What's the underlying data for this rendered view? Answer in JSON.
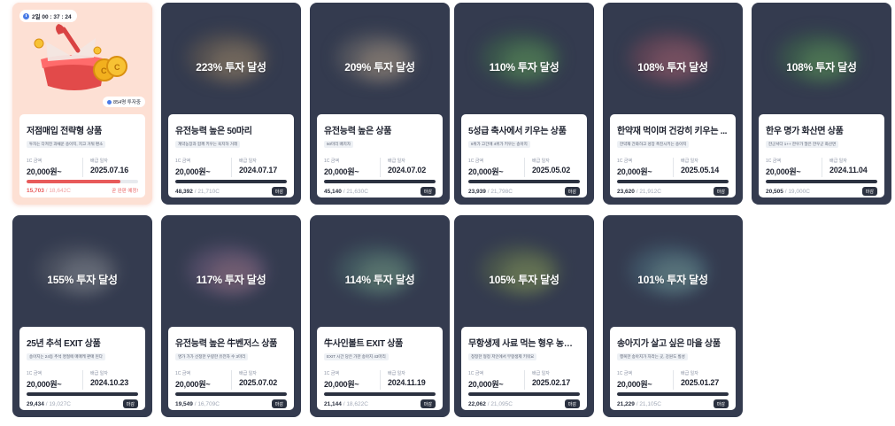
{
  "featured": {
    "timer": "2일 00 : 37 : 24",
    "investors": "854명 투자중",
    "title": "저점매입 전략형 상품",
    "tag": "투자는 다져진 과채운 송아지, 지고 거둬 편소",
    "amount_label": "1C 금액",
    "amount": "20,000원~",
    "date_label": "배급 일자",
    "date": "2025.07.16",
    "sold": "15,703",
    "total": "18,642C",
    "progress": 0.84,
    "status": "곧 완판 예정!"
  },
  "cards": [
    {
      "overlay": "223% 투자 달성",
      "title": "유전능력 높은 50마리",
      "tag": "계약농장과 함께 키우는 육지하 거래",
      "amount_label": "1C 금액",
      "amount": "20,000원~",
      "date_label": "배급 일자",
      "date": "2024.07.17",
      "sold": "48,392",
      "total": "21,710C",
      "progress": 1.0,
      "badge": "마감"
    },
    {
      "overlay": "209% 투자 달성",
      "title": "유전능력 높은 상품",
      "tag": "50마리 배치자",
      "amount_label": "1C 금액",
      "amount": "20,000원~",
      "date_label": "배급 일자",
      "date": "2024.07.02",
      "sold": "45,140",
      "total": "21,630C",
      "progress": 1.0,
      "badge": "마감"
    },
    {
      "overlay": "110% 투자 달성",
      "title": "5성급 축사에서 키우는 상품",
      "tag": "6위가 고간에 4위가 키우는 송아지",
      "amount_label": "1C 금액",
      "amount": "20,000원~",
      "date_label": "배급 일자",
      "date": "2025.05.02",
      "sold": "23,939",
      "total": "21,798C",
      "progress": 1.0,
      "badge": "마감"
    },
    {
      "overlay": "108% 투자 달성",
      "title": "한약재 먹이며 건강히 키우는 ...",
      "tag": "한약재 간화하고 성장 촉진시키는 송아지",
      "amount_label": "1C 금액",
      "amount": "20,000원~",
      "date_label": "배급 일자",
      "date": "2025.05.14",
      "sold": "23,620",
      "total": "21,912C",
      "progress": 1.0,
      "badge": "마감"
    },
    {
      "overlay": "108% 투자 달성",
      "title": "한우 명가 화산면 상품",
      "tag": "한군서다 1++ 한우가 많은 한우군 화산면",
      "amount_label": "1C 금액",
      "amount": "20,000원~",
      "date_label": "배급 일자",
      "date": "2024.11.04",
      "sold": "20,505",
      "total": "19,000C",
      "progress": 1.0,
      "badge": "마감"
    },
    {
      "overlay": "155% 투자 달성",
      "title": "25년 추석 EXIT 상품",
      "tag": "송아지는 24등 추석 명절에 매매케 판매 된다",
      "amount_label": "1C 금액",
      "amount": "20,000원~",
      "date_label": "배급 일자",
      "date": "2024.10.23",
      "sold": "29,434",
      "total": "19,027C",
      "progress": 1.0,
      "badge": "마감"
    },
    {
      "overlay": "117% 투자 달성",
      "title": "유전능력 높은 牛벤저스 상품",
      "tag": "명가 가가 선정한 우량한 유전자 수 3마리",
      "amount_label": "1C 금액",
      "amount": "20,000원~",
      "date_label": "배급 일자",
      "date": "2025.07.02",
      "sold": "19,549",
      "total": "16,709C",
      "progress": 1.0,
      "badge": "마감"
    },
    {
      "overlay": "114% 투자 달성",
      "title": "牛사인볼트 EXIT 상품",
      "tag": "EXIT 시간 당은 가한 송아지 43마리",
      "amount_label": "1C 금액",
      "amount": "20,000원~",
      "date_label": "배급 일자",
      "date": "2024.11.19",
      "sold": "21,144",
      "total": "18,622C",
      "progress": 1.0,
      "badge": "마감"
    },
    {
      "overlay": "105% 투자 달성",
      "title": "무항생제 사료 먹는 형우 농장 ...",
      "tag": "청정한 형정 저인에서 무항생제 키워요",
      "amount_label": "1C 금액",
      "amount": "20,000원~",
      "date_label": "배급 일자",
      "date": "2025.02.17",
      "sold": "22,062",
      "total": "21,095C",
      "progress": 1.0,
      "badge": "마감"
    },
    {
      "overlay": "101% 투자 달성",
      "title": "송아지가 살고 싶은 마을 상품",
      "tag": "행복한 송아지가 자라는 곳, 강원도 횡성",
      "amount_label": "1C 금액",
      "amount": "20,000원~",
      "date_label": "배급 일자",
      "date": "2025.01.27",
      "sold": "21,229",
      "total": "21,105C",
      "progress": 1.0,
      "badge": "마감"
    }
  ],
  "colors": {
    "card_bg": "#343b4f",
    "featured_bg": "#fde0d4",
    "accent_red": "#e85a5a",
    "badge_dark": "#2b3140"
  }
}
